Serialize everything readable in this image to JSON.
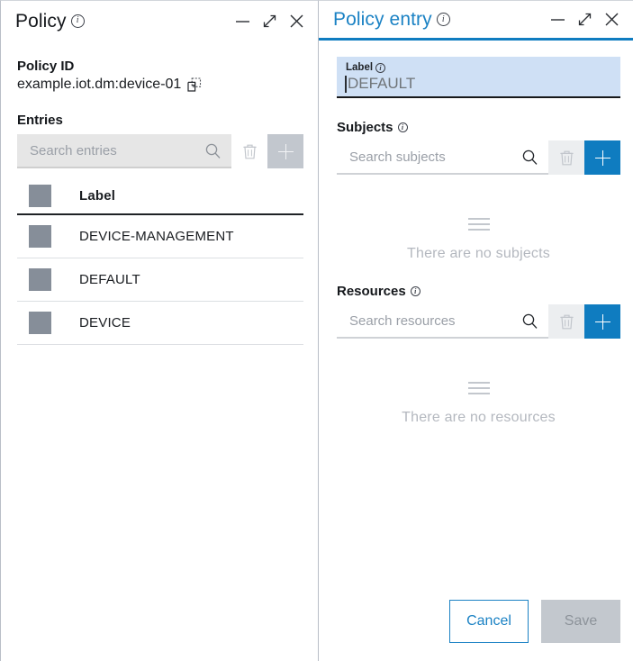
{
  "colors": {
    "accent_blue": "#0f7cc0",
    "title_blue": "#1b82c4",
    "label_field_bg": "#cfe0f5",
    "disabled_gray": "#c3c8ce",
    "placeholder_square": "#868e99"
  },
  "left_panel": {
    "title": "Policy",
    "info_icon": "info-icon",
    "window_controls": [
      {
        "name": "minimize-icon",
        "glyph": "minimize"
      },
      {
        "name": "expand-icon",
        "glyph": "expand"
      },
      {
        "name": "close-icon",
        "glyph": "close"
      }
    ],
    "policy_id": {
      "label": "Policy ID",
      "value": "example.iot.dm:device-01",
      "copy_icon": "copy-icon"
    },
    "entries": {
      "heading": "Entries",
      "search_placeholder": "Search entries",
      "search_value": "",
      "search_icon": "search-icon",
      "delete_icon": "trash-icon",
      "add_icon": "plus-icon",
      "toolbar_disabled": true,
      "columns": [
        "",
        "Label"
      ],
      "rows": [
        {
          "icon": "placeholder-square",
          "label": "DEVICE-MANAGEMENT"
        },
        {
          "icon": "placeholder-square",
          "label": "DEFAULT"
        },
        {
          "icon": "placeholder-square",
          "label": "DEVICE"
        }
      ]
    }
  },
  "right_panel": {
    "title": "Policy entry",
    "info_icon": "info-icon",
    "window_controls": [
      {
        "name": "minimize-icon",
        "glyph": "minimize"
      },
      {
        "name": "expand-icon",
        "glyph": "expand"
      },
      {
        "name": "close-icon",
        "glyph": "close"
      }
    ],
    "label_field": {
      "label": "Label",
      "value": "DEFAULT",
      "focused": true
    },
    "subjects": {
      "heading": "Subjects",
      "search_placeholder": "Search subjects",
      "search_value": "",
      "search_icon": "search-icon",
      "delete_icon": "trash-icon",
      "add_icon": "plus-icon",
      "empty_text": "There are no subjects",
      "empty_icon": "list-icon"
    },
    "resources": {
      "heading": "Resources",
      "search_placeholder": "Search resources",
      "search_value": "",
      "search_icon": "search-icon",
      "delete_icon": "trash-icon",
      "add_icon": "plus-icon",
      "empty_text": "There are no resources",
      "empty_icon": "list-icon"
    },
    "footer": {
      "cancel_label": "Cancel",
      "save_label": "Save",
      "save_disabled": true
    }
  }
}
